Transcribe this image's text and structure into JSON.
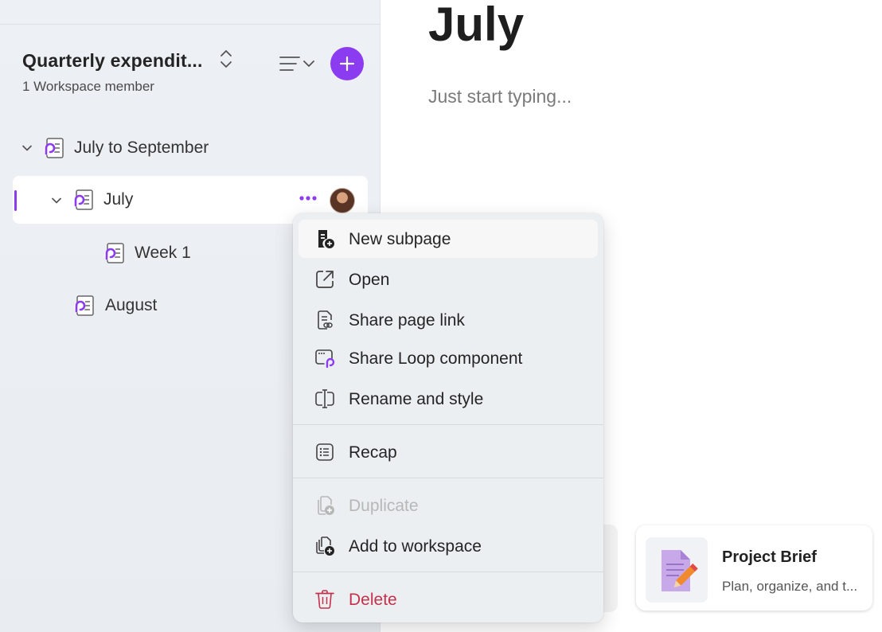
{
  "workspace": {
    "title": "Quarterly expendit...",
    "members": "1 Workspace member"
  },
  "tree": [
    {
      "label": "July to September",
      "expanded": true
    },
    {
      "label": "July",
      "expanded": true,
      "selected": true
    },
    {
      "label": "Week 1"
    },
    {
      "label": "August"
    }
  ],
  "page": {
    "title": "July",
    "placeholder": "Just start typing..."
  },
  "context_menu": {
    "items": [
      {
        "label": "New subpage",
        "icon": "new-subpage-icon"
      },
      {
        "label": "Open",
        "icon": "open-external-icon"
      },
      {
        "label": "Share page link",
        "icon": "share-link-icon"
      },
      {
        "label": "Share Loop component",
        "icon": "loop-component-icon"
      },
      {
        "label": "Rename and style",
        "icon": "rename-icon"
      },
      {
        "label": "Recap",
        "icon": "recap-list-icon"
      },
      {
        "label": "Duplicate",
        "icon": "duplicate-icon",
        "disabled": true
      },
      {
        "label": "Add to workspace",
        "icon": "add-to-workspace-icon"
      },
      {
        "label": "Delete",
        "icon": "trash-icon",
        "danger": true
      }
    ]
  },
  "template_card": {
    "title": "Project Brief",
    "description": "Plan, organize, and t..."
  },
  "colors": {
    "accent": "#8b3cf0",
    "danger": "#c4314b"
  }
}
